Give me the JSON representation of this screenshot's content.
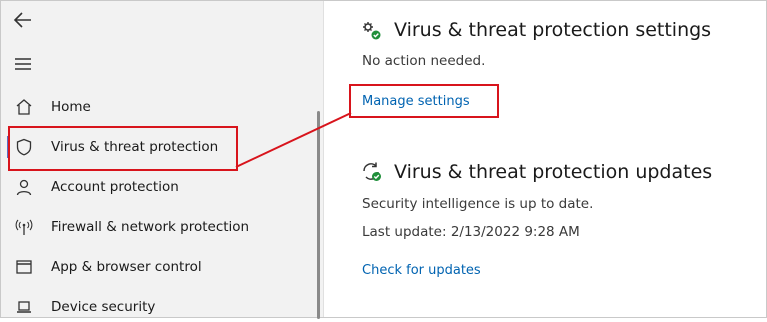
{
  "sidebar": {
    "back_icon": "back-arrow-icon",
    "menu_icon": "hamburger-menu-icon",
    "items": [
      {
        "label": "Home",
        "icon": "home-icon"
      },
      {
        "label": "Virus & threat protection",
        "icon": "shield-icon"
      },
      {
        "label": "Account protection",
        "icon": "person-icon"
      },
      {
        "label": "Firewall & network protection",
        "icon": "antenna-icon"
      },
      {
        "label": "App & browser control",
        "icon": "app-window-icon"
      },
      {
        "label": "Device security",
        "icon": "laptop-icon"
      }
    ],
    "active_index": 1
  },
  "settings": {
    "title": "Virus & threat protection settings",
    "status": "No action needed.",
    "link": "Manage settings",
    "icon": "gear-check-icon"
  },
  "updates": {
    "title": "Virus & threat protection updates",
    "status": "Security intelligence is up to date.",
    "last_update": "Last update: 2/13/2022 9:28 AM",
    "link": "Check for updates",
    "icon": "refresh-check-icon"
  },
  "colors": {
    "annotation_red": "#d8141c",
    "link_blue": "#0063b1",
    "check_green": "#1f8f3a",
    "sidebar_bg": "#f2f2f2"
  }
}
